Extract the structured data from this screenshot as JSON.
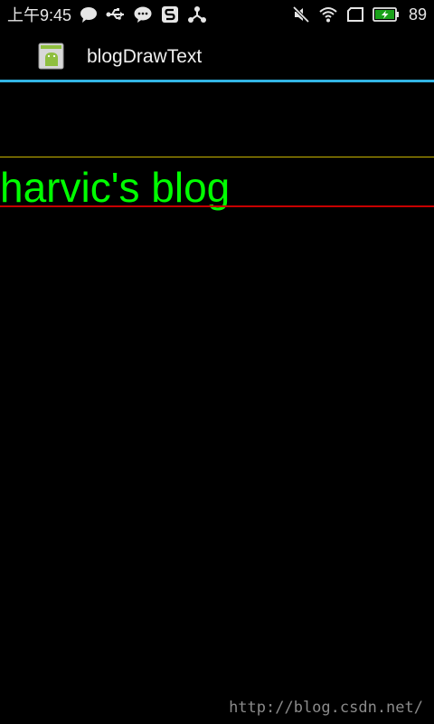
{
  "status_bar": {
    "time": "上午9:45",
    "battery_level": "89",
    "left_icons": [
      "chat-bubble-icon",
      "usb-icon",
      "wechat-icon",
      "s-app-icon",
      "share-icon"
    ],
    "right_icons": [
      "mute-icon",
      "wifi-icon",
      "screen-icon",
      "battery-charging-icon"
    ]
  },
  "action_bar": {
    "title": "blogDrawText",
    "icon": "android-app-icon"
  },
  "canvas": {
    "drawn_text": "harvic's blog",
    "text_color": "#00ff00",
    "top_line_color": "#c8b400",
    "baseline_color": "#c80000"
  },
  "colors": {
    "action_divider": "#33b5e5",
    "background": "#000000"
  },
  "watermark": "http://blog.csdn.net/"
}
